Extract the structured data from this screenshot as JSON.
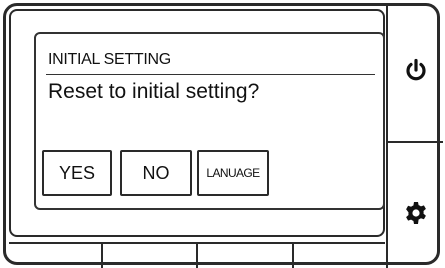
{
  "dialog": {
    "title": "INITIAL SETTING",
    "message": "Reset to initial setting?",
    "buttons": {
      "yes": "YES",
      "no": "NO",
      "language": "LANUAGE"
    }
  },
  "side_buttons": {
    "power_icon": "power-icon",
    "settings_icon": "gear-icon"
  },
  "soft_keys_count": 4
}
